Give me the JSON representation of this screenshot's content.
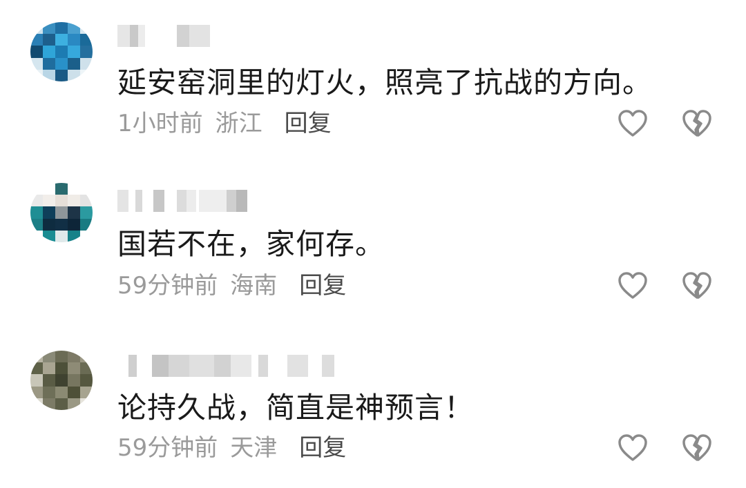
{
  "comments": [
    {
      "text": "延安窑洞里的灯火，照亮了抗战的方向。",
      "time": "1小时前",
      "location": "浙江",
      "reply_label": "回复"
    },
    {
      "text": "国若不在，家何存。",
      "time": "59分钟前",
      "location": "海南",
      "reply_label": "回复"
    },
    {
      "text": "论持久战，简直是神预言！",
      "time": "59分钟前",
      "location": "天津",
      "reply_label": "回复"
    }
  ],
  "icons": {
    "like": "heart-icon",
    "dislike": "broken-heart-icon"
  },
  "colors": {
    "text": "#1a1a1a",
    "meta": "#9a9a9a",
    "reply": "#4a4a4a",
    "icon": "#8a8a8a"
  }
}
